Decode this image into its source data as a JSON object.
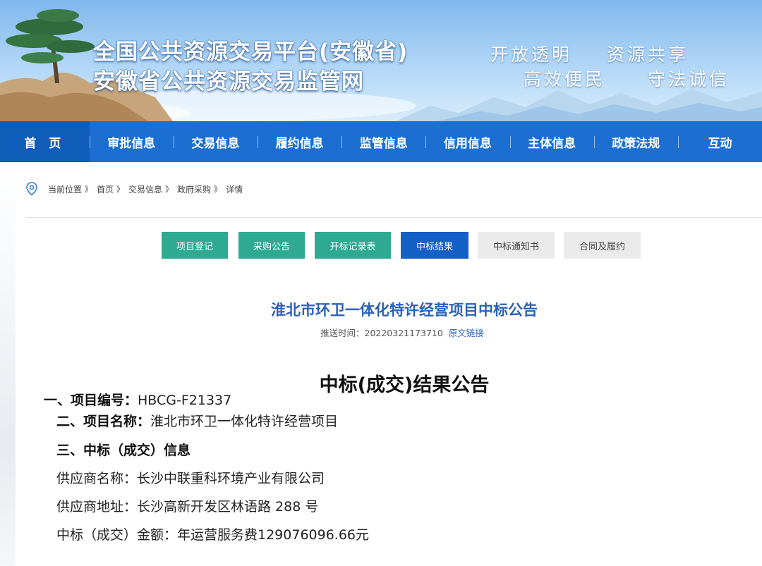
{
  "banner": {
    "title_line1": "全国公共资源交易平台(安徽省)",
    "title_line2": "安徽省公共资源交易监管网",
    "slogans": [
      "开放透明",
      "资源共享",
      "高效便民",
      "守法诚信"
    ]
  },
  "nav": {
    "items": [
      "首 页",
      "审批信息",
      "交易信息",
      "履约信息",
      "监管信息",
      "信用信息",
      "主体信息",
      "政策法规",
      "互动"
    ]
  },
  "breadcrumb": {
    "items": [
      "当前位置",
      "首页",
      "交易信息",
      "政府采购",
      "详情"
    ],
    "separator": "》"
  },
  "tabs": [
    "项目登记",
    "采购公告",
    "开标记录表",
    "中标结果",
    "中标通知书",
    "合同及履约"
  ],
  "active_tab": "中标结果",
  "document": {
    "title": "淮北市环卫一体化特许经营项目中标公告",
    "push_time": "推送时间：20220321173710",
    "source_link": "原文链接",
    "notice_title": "中标(成交)结果公告",
    "l1_label": "一、项目编号：",
    "l1_value": "HBCG-F21337",
    "l2_label": "二、项目名称：",
    "l2_value": "淮北市环卫一体化特许经营项目",
    "l3_label": "三、中标（成交）信息",
    "supplier_name": "供应商名称：长沙中联重科环境产业有限公司",
    "supplier_address": "供应商地址：长沙高新开发区林语路 288 号",
    "amount": "中标（成交）金额：年运营服务费129076096.66元"
  },
  "colors": {
    "nav_bg": "#1c6fd1",
    "nav_active": "#0f5cb9",
    "tab_green": "#2eaa93",
    "tab_active": "#1560c6",
    "tab_gray": "#eaeaea",
    "title_blue": "#2a62b8"
  },
  "icons": {
    "breadcrumb": "location-pin-icon"
  }
}
